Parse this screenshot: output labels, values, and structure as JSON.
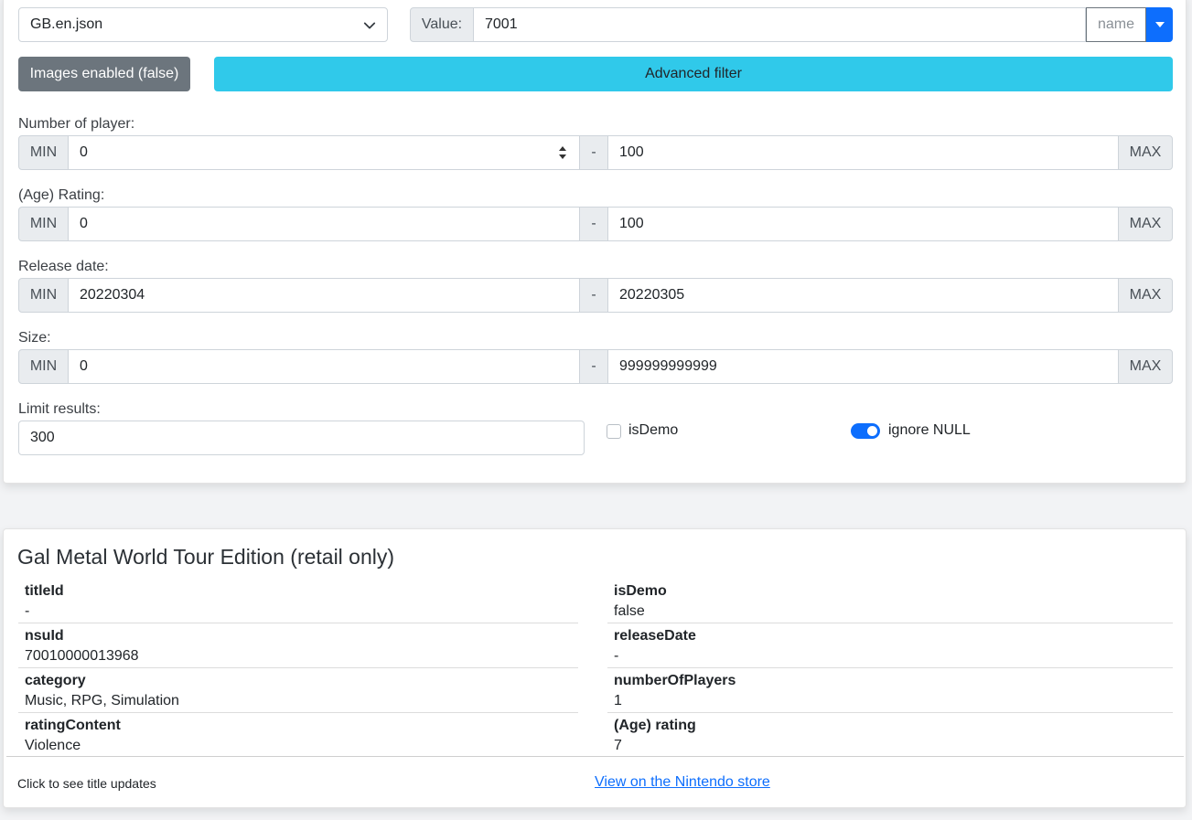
{
  "filter": {
    "file_select": "GB.en.json",
    "value_label": "Value:",
    "value_input": "7001",
    "value_field_select": "name",
    "images_button": "Images enabled (false)",
    "advanced_button": "Advanced filter",
    "ranges": [
      {
        "label": "Number of player:",
        "min_label": "MIN",
        "min": "0",
        "dash": "-",
        "max": "100",
        "max_label": "MAX"
      },
      {
        "label": "(Age) Rating:",
        "min_label": "MIN",
        "min": "0",
        "dash": "-",
        "max": "100",
        "max_label": "MAX"
      },
      {
        "label": "Release date:",
        "min_label": "MIN",
        "min": "20220304",
        "dash": "-",
        "max": "20220305",
        "max_label": "MAX"
      },
      {
        "label": "Size:",
        "min_label": "MIN",
        "min": "0",
        "dash": "-",
        "max": "999999999999",
        "max_label": "MAX"
      }
    ],
    "limit_label": "Limit results:",
    "limit_value": "300",
    "isdemo_label": "isDemo",
    "isdemo_checked": false,
    "ignore_null_label": "ignore NULL",
    "ignore_null_on": true
  },
  "result": {
    "title": "Gal Metal World Tour Edition (retail only)",
    "left_fields": [
      {
        "key": "titleId",
        "value": "-"
      },
      {
        "key": "nsuId",
        "value": "70010000013968"
      },
      {
        "key": "category",
        "value": "Music, RPG, Simulation"
      },
      {
        "key": "ratingContent",
        "value": "Violence"
      }
    ],
    "right_fields": [
      {
        "key": "isDemo",
        "value": "false"
      },
      {
        "key": "releaseDate",
        "value": "-"
      },
      {
        "key": "numberOfPlayers",
        "value": "1"
      },
      {
        "key": "(Age) rating",
        "value": "7"
      }
    ],
    "footer_text": "Click to see title updates",
    "store_link": "View on the Nintendo store"
  },
  "colors": {
    "primary": "#0d6efd",
    "info": "#30c9ea",
    "secondary": "#6c757d"
  }
}
